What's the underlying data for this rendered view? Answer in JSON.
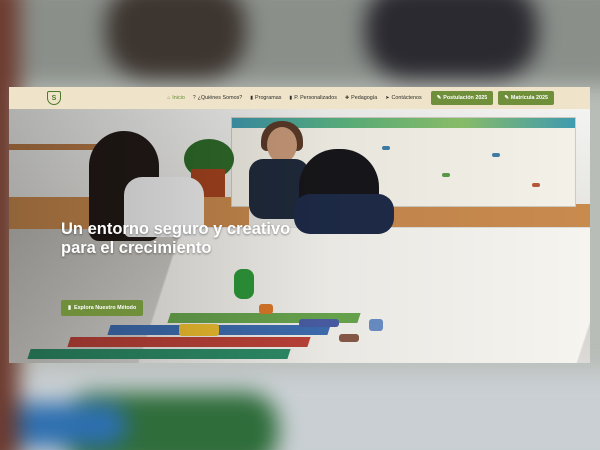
{
  "header": {
    "logo_text": "S",
    "nav": [
      {
        "icon": "home-icon",
        "glyph": "⌂",
        "label": "Inicio",
        "active": true
      },
      {
        "icon": "question-icon",
        "glyph": "?",
        "label": "¿Quiénes Somos?"
      },
      {
        "icon": "book-icon",
        "glyph": "▮",
        "label": "Programas"
      },
      {
        "icon": "book-icon",
        "glyph": "▮",
        "label": "P. Personalizados"
      },
      {
        "icon": "puzzle-icon",
        "glyph": "✚",
        "label": "Pedagogía"
      },
      {
        "icon": "paper-plane-icon",
        "glyph": "➤",
        "label": "Contáctenos"
      }
    ],
    "cta": [
      {
        "icon": "pencil-icon",
        "glyph": "✎",
        "label": "Postulación 2025"
      },
      {
        "icon": "pencil-icon",
        "glyph": "✎",
        "label": "Matrícula 2025"
      }
    ]
  },
  "hero": {
    "title": "Un entorno seguro y creativo para el crecimiento",
    "button_label": "Explora Nuestro Método",
    "button_icon": "book-icon",
    "button_glyph": "▮"
  },
  "colors": {
    "accent": "#6f8f3a",
    "header_bg": "#efe4c9"
  }
}
